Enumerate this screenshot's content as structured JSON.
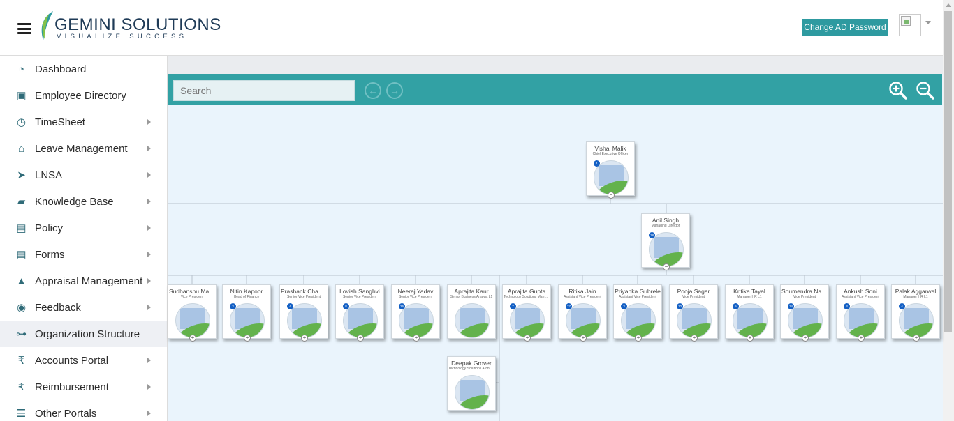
{
  "header": {
    "logo_name": "GEMINI SOLUTIONS",
    "logo_tagline": "VISUALIZE SUCCESS",
    "change_password_label": "Change AD Password",
    "brand_color": "#2e9aa0"
  },
  "sidebar": {
    "items": [
      {
        "label": "Dashboard",
        "icon": "dashboard-icon",
        "has_arrow": false,
        "active": false
      },
      {
        "label": "Employee Directory",
        "icon": "id-card-icon",
        "has_arrow": false,
        "active": false
      },
      {
        "label": "TimeSheet",
        "icon": "clock-icon",
        "has_arrow": true,
        "active": false
      },
      {
        "label": "Leave Management",
        "icon": "home-icon",
        "has_arrow": true,
        "active": false
      },
      {
        "label": "LNSA",
        "icon": "paper-plane-icon",
        "has_arrow": true,
        "active": false
      },
      {
        "label": "Knowledge Base",
        "icon": "folder-open-icon",
        "has_arrow": true,
        "active": false
      },
      {
        "label": "Policy",
        "icon": "document-icon",
        "has_arrow": true,
        "active": false
      },
      {
        "label": "Forms",
        "icon": "form-icon",
        "has_arrow": true,
        "active": false
      },
      {
        "label": "Appraisal Management",
        "icon": "graduation-cap-icon",
        "has_arrow": true,
        "active": false
      },
      {
        "label": "Feedback",
        "icon": "chat-bubbles-icon",
        "has_arrow": true,
        "active": false
      },
      {
        "label": "Organization Structure",
        "icon": "sitemap-icon",
        "has_arrow": false,
        "active": true
      },
      {
        "label": "Accounts Portal",
        "icon": "rupee-icon",
        "has_arrow": true,
        "active": false
      },
      {
        "label": "Reimbursement",
        "icon": "rupee-icon",
        "has_arrow": true,
        "active": false
      },
      {
        "label": "Other Portals",
        "icon": "list-icon",
        "has_arrow": true,
        "active": false
      }
    ]
  },
  "toolbar": {
    "search_placeholder": "Search"
  },
  "org": {
    "ceo": {
      "name": "Vishal Malik",
      "title": "Chief Executive Officer",
      "count": "1",
      "toggle": "−"
    },
    "md": {
      "name": "Anil Singh",
      "title": "Managing Director",
      "count": "18",
      "toggle": "−"
    },
    "reports": [
      {
        "name": "Sudhanshu Malh...",
        "title": "Vice President",
        "count": "",
        "toggle": "+"
      },
      {
        "name": "Nitin Kapoor",
        "title": "Head of Finance",
        "count": "3",
        "toggle": "+"
      },
      {
        "name": "Prashank Chaudhary",
        "title": "Senior Vice President",
        "count": "4",
        "toggle": "+"
      },
      {
        "name": "Lovish Sanghvi",
        "title": "Senior Vice President",
        "count": "8",
        "toggle": "+"
      },
      {
        "name": "Neeraj Yadav",
        "title": "Senior Vice President",
        "count": "26",
        "toggle": "+"
      },
      {
        "name": "Aprajita Kaur",
        "title": "Senior Business Analyst L1",
        "count": "",
        "toggle": ""
      },
      {
        "name": "Aprajita Gupta",
        "title": "Technology Solutions Manag...",
        "count": "7",
        "toggle": "+"
      },
      {
        "name": "Ritika Jain",
        "title": "Assistant Vice President",
        "count": "27",
        "toggle": "+"
      },
      {
        "name": "Priyanka Gubrele",
        "title": "Assistant Vice President",
        "count": "3",
        "toggle": "+"
      },
      {
        "name": "Pooja Sagar",
        "title": "Vice President",
        "count": "10",
        "toggle": "+"
      },
      {
        "name": "Kritika Tayal",
        "title": "Manager HR L1",
        "count": "5",
        "toggle": "+"
      },
      {
        "name": "Soumendra Nath...",
        "title": "Vice President",
        "count": "14",
        "toggle": "+"
      },
      {
        "name": "Ankush Soni",
        "title": "Assistant Vice President",
        "count": "3",
        "toggle": "+"
      },
      {
        "name": "Palak Aggarwal",
        "title": "Manager HR L1",
        "count": "4",
        "toggle": "+"
      }
    ],
    "extra": {
      "name": "Deepak Grover",
      "title": "Technology Solutions Archite...",
      "count": "",
      "toggle": ""
    }
  }
}
